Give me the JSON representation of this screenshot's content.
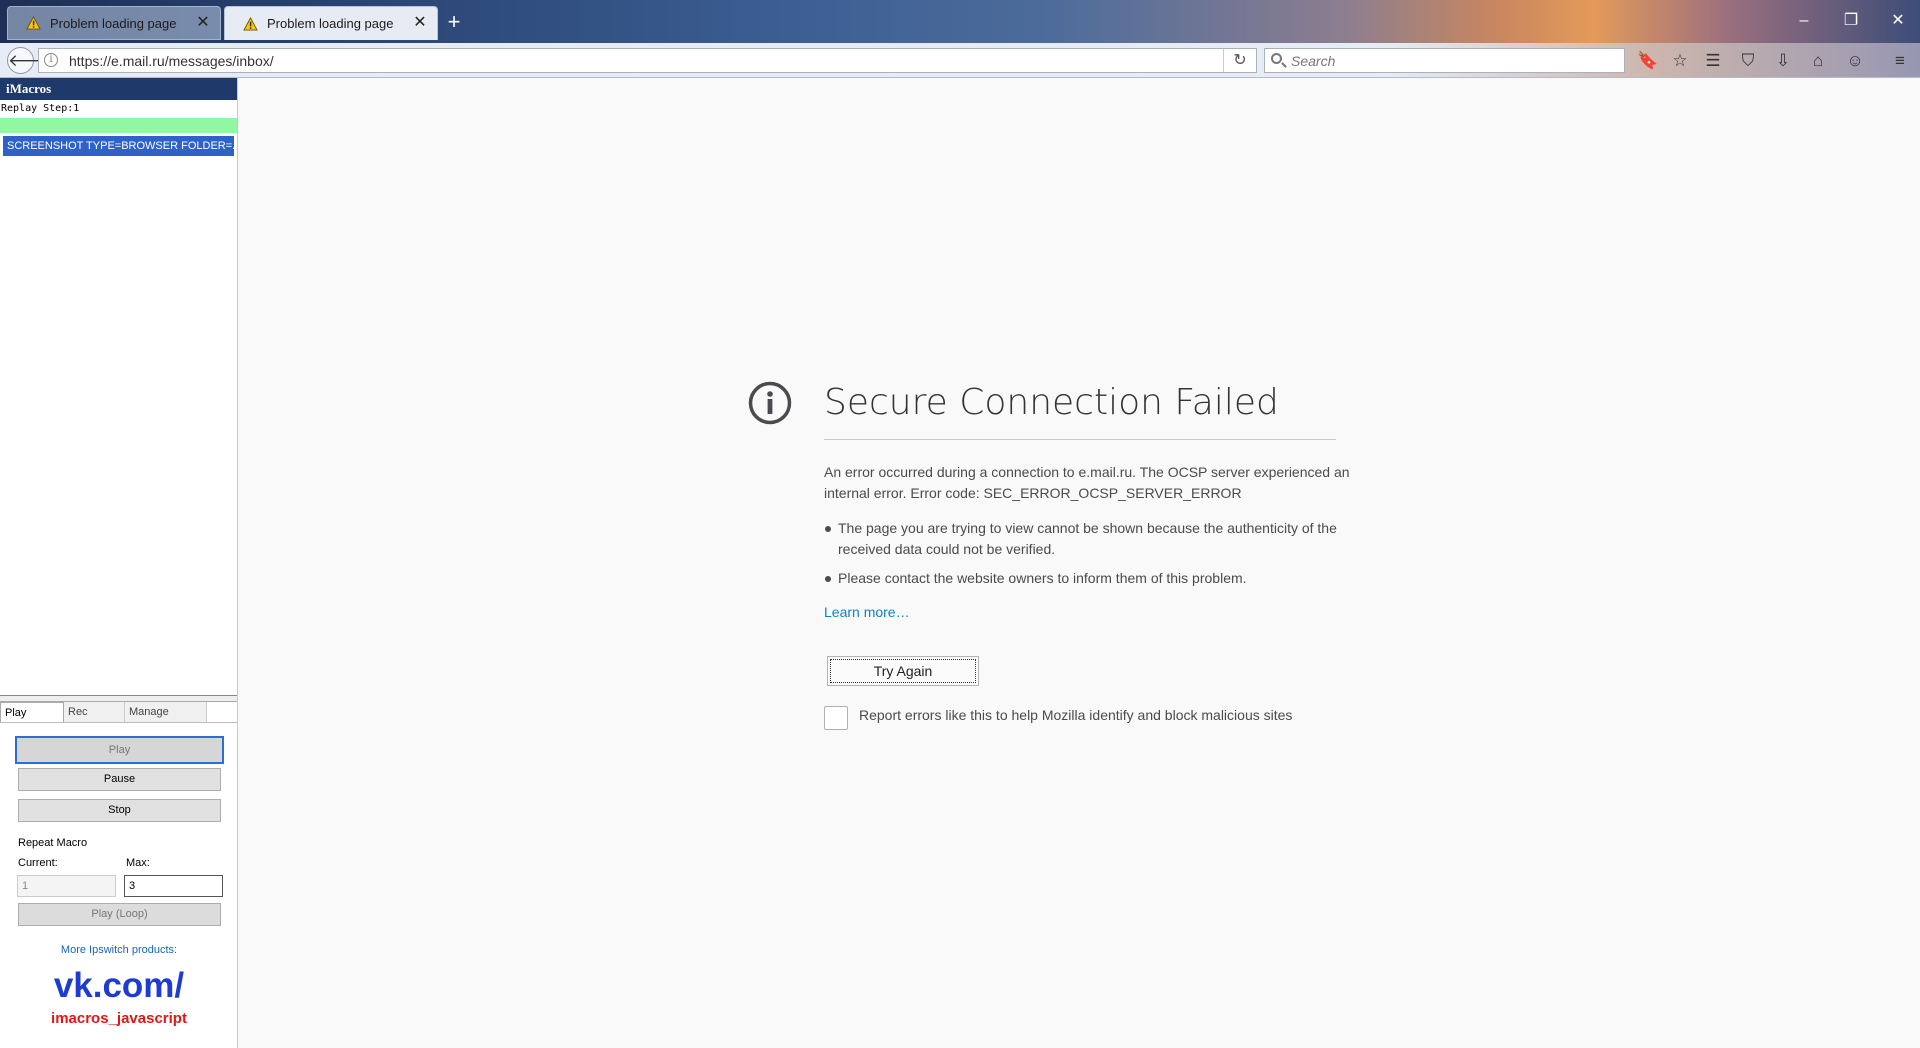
{
  "browser": {
    "tabs": [
      {
        "title": "Problem loading page",
        "active": false
      },
      {
        "title": "Problem loading page",
        "active": true
      }
    ],
    "url": "https://e.mail.ru/messages/inbox/",
    "search_placeholder": "Search",
    "window_controls": [
      "minimize-icon",
      "restore-icon",
      "close-icon"
    ],
    "toolbar_icons": [
      "imacros-icon",
      "bookmark-star-icon",
      "reading-list-icon",
      "pocket-icon",
      "downloads-icon",
      "home-icon",
      "smiley-icon",
      "menu-icon"
    ]
  },
  "imacros": {
    "title": "iMacros",
    "replay_step": "Replay Step:1",
    "macro_line": "SCREENSHOT TYPE=BROWSER FOLDER=...",
    "tabs": {
      "play": "Play",
      "rec": "Rec",
      "manage": "Manage"
    },
    "buttons": {
      "play": "Play",
      "pause": "Pause",
      "stop": "Stop",
      "play_loop": "Play (Loop)"
    },
    "repeat_label": "Repeat Macro",
    "current_label": "Current:",
    "max_label": "Max:",
    "current_value": "1",
    "max_value": "3",
    "more_products": "More Ipswitch products:",
    "promo_line1": "vk.com/",
    "promo_line2": "imacros_javascript"
  },
  "error_page": {
    "title": "Secure Connection Failed",
    "description": "An error occurred during a connection to e.mail.ru. The OCSP server experienced an internal error. Error code: SEC_ERROR_OCSP_SERVER_ERROR",
    "bullets": [
      "The page you are trying to view cannot be shown because the authenticity of the received data could not be verified.",
      "Please contact the website owners to inform them of this problem."
    ],
    "learn_more": "Learn more…",
    "try_again": "Try Again",
    "report_label": "Report errors like this to help Mozilla identify and block malicious sites",
    "report_checked": false
  },
  "colors": {
    "sidebar_header": "#1e3a6a",
    "progress": "#92f7a2",
    "selected_line": "#2f62c8",
    "link": "#0a84c9",
    "promo_blue": "#1e3cd2",
    "promo_red": "#e01717"
  }
}
